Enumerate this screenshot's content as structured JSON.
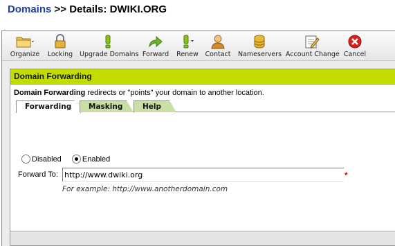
{
  "page": {
    "breadcrumb_link": "Domains",
    "breadcrumb_rest": " >> Details: DWIKI.ORG"
  },
  "toolbar": {
    "items": [
      {
        "label": "Organize",
        "icon": "folder-icon"
      },
      {
        "label": "Locking",
        "icon": "lock-icon"
      },
      {
        "label": "Upgrade Domains",
        "icon": "exclamation-icon"
      },
      {
        "label": "Forward",
        "icon": "forward-arrow-icon"
      },
      {
        "label": "Renew",
        "icon": "renew-icon"
      },
      {
        "label": "Contact",
        "icon": "contact-person-icon"
      },
      {
        "label": "Nameservers",
        "icon": "database-icon"
      },
      {
        "label": "Account Change",
        "icon": "edit-document-icon"
      },
      {
        "label": "Cancel",
        "icon": "cancel-icon"
      }
    ]
  },
  "panel": {
    "title": "Domain Forwarding",
    "desc_bold": "Domain Forwarding",
    "desc_rest": " redirects or \"points\" your domain to another location."
  },
  "tabs": [
    {
      "label": "Forwarding",
      "active": true
    },
    {
      "label": "Masking",
      "active": false
    },
    {
      "label": "Help",
      "active": false
    }
  ],
  "form": {
    "disabled_label": "Disabled",
    "enabled_label": "Enabled",
    "selected": "Enabled",
    "forward_label": "Forward To:",
    "forward_value": "http://www.dwiki.org",
    "required_mark": "*",
    "example": "For example: http://www.anotherdomain.com"
  },
  "colors": {
    "accent_green": "#c3dc00",
    "tab_green": "#c9dfa6",
    "link_blue": "#1a3f9c",
    "required_red": "#cc1111"
  }
}
